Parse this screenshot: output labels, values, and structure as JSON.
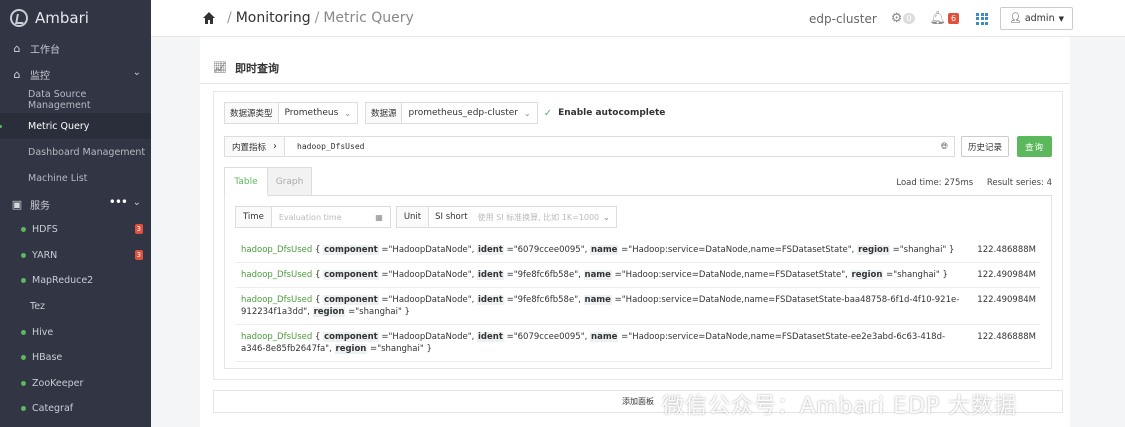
{
  "sidebar": {
    "brand": "Ambari",
    "workspace": "工作台",
    "monitor": "监控",
    "monitor_items": [
      "Data Source Management",
      "Metric Query",
      "Dashboard Management",
      "Machine List"
    ],
    "services": "服务",
    "service_items": [
      {
        "label": "HDFS",
        "badge": "3",
        "dot": true
      },
      {
        "label": "YARN",
        "badge": "3",
        "dot": true
      },
      {
        "label": "MapReduce2",
        "badge": "",
        "dot": true
      },
      {
        "label": "Tez",
        "badge": "",
        "dot": false
      },
      {
        "label": "Hive",
        "badge": "",
        "dot": true
      },
      {
        "label": "HBase",
        "badge": "",
        "dot": true
      },
      {
        "label": "ZooKeeper",
        "badge": "",
        "dot": true
      },
      {
        "label": "Categraf",
        "badge": "",
        "dot": true
      }
    ]
  },
  "topbar": {
    "crumb_monitoring": "Monitoring",
    "crumb_page": "Metric Query",
    "cluster": "edp-cluster",
    "gear_count": "0",
    "alert_count": "6",
    "user": "admin"
  },
  "panel": {
    "title": "即时查询"
  },
  "query": {
    "ds_type_label": "数据源类型",
    "ds_type_value": "Prometheus",
    "ds_label": "数据源",
    "ds_value": "prometheus_edp-cluster",
    "autocomplete": "Enable autocomplete",
    "builtin_label": "内置指标",
    "expr": "hadoop_DfsUsed",
    "history_btn": "历史记录",
    "query_btn": "查询"
  },
  "tabs": {
    "table": "Table",
    "graph": "Graph"
  },
  "load_time": "Load time: 275ms",
  "result_series": "Result series: 4",
  "filters": {
    "time_label": "Time",
    "time_placeholder": "Evaluation time",
    "unit_label": "Unit",
    "unit_value": "SI short",
    "unit_hint": "使用 SI 标准换算, 比如 1K=1000"
  },
  "results": [
    {
      "name": "hadoop_DfsUsed",
      "component": "\"HadoopDataNode\"",
      "ident": "\"6079ccee0095\"",
      "nm": "\"Hadoop:service=DataNode,name=FSDatasetState\"",
      "region": "\"shanghai\"",
      "value": "122.486888M"
    },
    {
      "name": "hadoop_DfsUsed",
      "component": "\"HadoopDataNode\"",
      "ident": "\"9fe8fc6fb58e\"",
      "nm": "\"Hadoop:service=DataNode,name=FSDatasetState\"",
      "region": "\"shanghai\"",
      "value": "122.490984M"
    },
    {
      "name": "hadoop_DfsUsed",
      "component": "\"HadoopDataNode\"",
      "ident": "\"9fe8fc6fb58e\"",
      "nm": "\"Hadoop:service=DataNode,name=FSDatasetState-baa48758-6f1d-4f10-921e-912234f1a3dd\"",
      "region": "\"shanghai\"",
      "value": "122.490984M"
    },
    {
      "name": "hadoop_DfsUsed",
      "component": "\"HadoopDataNode\"",
      "ident": "\"6079ccee0095\"",
      "nm": "\"Hadoop:service=DataNode,name=FSDatasetState-ee2e3abd-6c63-418d-a346-8e85fb2647fa\"",
      "region": "\"shanghai\"",
      "value": "122.486888M"
    }
  ],
  "add_panel": "添加面板",
  "watermark": "微信公众号：Ambari EDP 大数据"
}
